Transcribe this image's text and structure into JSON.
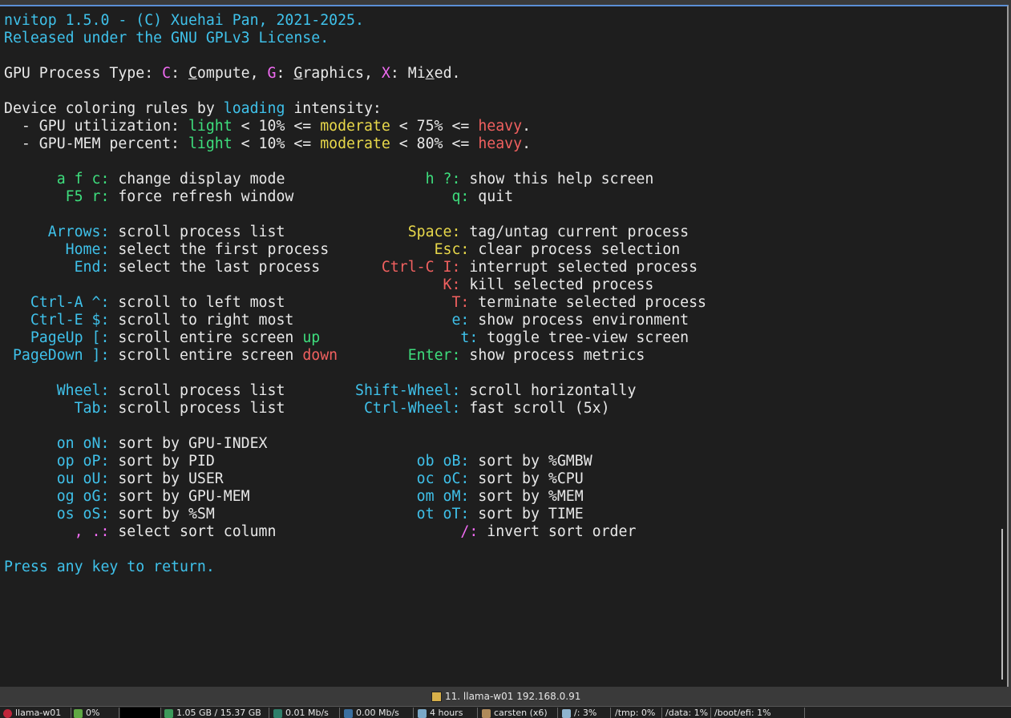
{
  "terminal": {
    "colors": {
      "background": "#1e1e1e",
      "cyan": "#3fc1ea",
      "green": "#3ede7d",
      "yellow": "#e8d84a",
      "red": "#f0605f",
      "magenta": "#f06bf2",
      "white": "#e8e8e8"
    },
    "lines": [
      {
        "row": 0,
        "segments": [
          {
            "t": "nvitop 1.5.0 - (C) Xuehai Pan, 2021-2025.",
            "c": "cy"
          }
        ]
      },
      {
        "row": 1,
        "segments": [
          {
            "t": "Released under the GNU GPLv3 License.",
            "c": "cy"
          }
        ]
      },
      {
        "row": 3,
        "segments": [
          {
            "t": "GPU Process Type: ",
            "c": "wh"
          },
          {
            "t": "C",
            "c": "mg"
          },
          {
            "t": ": ",
            "c": "wh"
          },
          {
            "t": "C",
            "c": "wh",
            "u": true
          },
          {
            "t": "ompute, ",
            "c": "wh"
          },
          {
            "t": "G",
            "c": "mg"
          },
          {
            "t": ": ",
            "c": "wh"
          },
          {
            "t": "G",
            "c": "wh",
            "u": true
          },
          {
            "t": "raphics, ",
            "c": "wh"
          },
          {
            "t": "X",
            "c": "mg"
          },
          {
            "t": ": Mi",
            "c": "wh"
          },
          {
            "t": "x",
            "c": "wh",
            "u": true
          },
          {
            "t": "ed.",
            "c": "wh"
          }
        ]
      },
      {
        "row": 5,
        "segments": [
          {
            "t": "Device coloring rules by ",
            "c": "wh"
          },
          {
            "t": "loading",
            "c": "cy"
          },
          {
            "t": " intensity:",
            "c": "wh"
          }
        ]
      },
      {
        "row": 6,
        "segments": [
          {
            "t": "  - GPU utilization: ",
            "c": "wh"
          },
          {
            "t": "light",
            "c": "gr"
          },
          {
            "t": " < 10% <= ",
            "c": "wh"
          },
          {
            "t": "moderate",
            "c": "ye"
          },
          {
            "t": " < 75% <= ",
            "c": "wh"
          },
          {
            "t": "heavy",
            "c": "rd"
          },
          {
            "t": ".",
            "c": "wh"
          }
        ]
      },
      {
        "row": 7,
        "segments": [
          {
            "t": "  - GPU-MEM percent: ",
            "c": "wh"
          },
          {
            "t": "light",
            "c": "gr"
          },
          {
            "t": " < 10% <= ",
            "c": "wh"
          },
          {
            "t": "moderate",
            "c": "ye"
          },
          {
            "t": " < 80% <= ",
            "c": "wh"
          },
          {
            "t": "heavy",
            "c": "rd"
          },
          {
            "t": ".",
            "c": "wh"
          }
        ]
      },
      {
        "row": 9,
        "segments": [
          {
            "t": "      a f c:",
            "c": "gr"
          },
          {
            "t": " change display mode               ",
            "c": "wh"
          },
          {
            "t": " h ?:",
            "c": "gr"
          },
          {
            "t": " show this help screen",
            "c": "wh"
          }
        ]
      },
      {
        "row": 10,
        "segments": [
          {
            "t": "       F5 r:",
            "c": "gr"
          },
          {
            "t": " force refresh window                  ",
            "c": "wh"
          },
          {
            "t": "q:",
            "c": "gr"
          },
          {
            "t": " quit",
            "c": "wh"
          }
        ]
      },
      {
        "row": 12,
        "segments": [
          {
            "t": "     Arrows:",
            "c": "cy"
          },
          {
            "t": " scroll process list              ",
            "c": "wh"
          },
          {
            "t": "Space:",
            "c": "ye"
          },
          {
            "t": " tag/untag current process",
            "c": "wh"
          }
        ]
      },
      {
        "row": 13,
        "segments": [
          {
            "t": "       Home:",
            "c": "cy"
          },
          {
            "t": " select the first process            ",
            "c": "wh"
          },
          {
            "t": "Esc:",
            "c": "ye"
          },
          {
            "t": " clear process selection",
            "c": "wh"
          }
        ]
      },
      {
        "row": 14,
        "segments": [
          {
            "t": "        End:",
            "c": "cy"
          },
          {
            "t": " select the last process       ",
            "c": "wh"
          },
          {
            "t": "Ctrl-C I:",
            "c": "rd"
          },
          {
            "t": " interrupt selected process",
            "c": "wh"
          }
        ]
      },
      {
        "row": 15,
        "segments": [
          {
            "t": "                                                  ",
            "c": "wh"
          },
          {
            "t": "K:",
            "c": "rd"
          },
          {
            "t": " kill selected process",
            "c": "wh"
          }
        ]
      },
      {
        "row": 16,
        "segments": [
          {
            "t": "   Ctrl-A ^:",
            "c": "cy"
          },
          {
            "t": " scroll to left most                   ",
            "c": "wh"
          },
          {
            "t": "T:",
            "c": "rd"
          },
          {
            "t": " terminate selected process",
            "c": "wh"
          }
        ]
      },
      {
        "row": 17,
        "segments": [
          {
            "t": "   Ctrl-E $:",
            "c": "cy"
          },
          {
            "t": " scroll to right most                  ",
            "c": "wh"
          },
          {
            "t": "e:",
            "c": "cy"
          },
          {
            "t": " show process environment",
            "c": "wh"
          }
        ]
      },
      {
        "row": 18,
        "segments": [
          {
            "t": "   PageUp [:",
            "c": "cy"
          },
          {
            "t": " scroll entire screen ",
            "c": "wh"
          },
          {
            "t": "up",
            "c": "gr"
          },
          {
            "t": "                ",
            "c": "wh"
          },
          {
            "t": "t:",
            "c": "cy"
          },
          {
            "t": " toggle tree-view screen",
            "c": "wh"
          }
        ]
      },
      {
        "row": 19,
        "segments": [
          {
            "t": " PageDown ]:",
            "c": "cy"
          },
          {
            "t": " scroll entire screen ",
            "c": "wh"
          },
          {
            "t": "down",
            "c": "rd"
          },
          {
            "t": "        ",
            "c": "wh"
          },
          {
            "t": "Enter:",
            "c": "gr"
          },
          {
            "t": " show process metrics",
            "c": "wh"
          }
        ]
      },
      {
        "row": 21,
        "segments": [
          {
            "t": "      Wheel:",
            "c": "cy"
          },
          {
            "t": " scroll process list        ",
            "c": "wh"
          },
          {
            "t": "Shift-Wheel:",
            "c": "cy"
          },
          {
            "t": " scroll horizontally",
            "c": "wh"
          }
        ]
      },
      {
        "row": 22,
        "segments": [
          {
            "t": "        Tab:",
            "c": "cy"
          },
          {
            "t": " scroll process list         ",
            "c": "wh"
          },
          {
            "t": "Ctrl-Wheel:",
            "c": "cy"
          },
          {
            "t": " fast scroll (5x)",
            "c": "wh"
          }
        ]
      },
      {
        "row": 24,
        "segments": [
          {
            "t": "      on oN:",
            "c": "cy"
          },
          {
            "t": " sort by GPU-INDEX",
            "c": "wh"
          }
        ]
      },
      {
        "row": 25,
        "segments": [
          {
            "t": "      op oP:",
            "c": "cy"
          },
          {
            "t": " sort by PID                       ",
            "c": "wh"
          },
          {
            "t": "ob oB:",
            "c": "cy"
          },
          {
            "t": " sort by %GMBW",
            "c": "wh"
          }
        ]
      },
      {
        "row": 26,
        "segments": [
          {
            "t": "      ou oU:",
            "c": "cy"
          },
          {
            "t": " sort by USER                      ",
            "c": "wh"
          },
          {
            "t": "oc oC:",
            "c": "cy"
          },
          {
            "t": " sort by %CPU",
            "c": "wh"
          }
        ]
      },
      {
        "row": 27,
        "segments": [
          {
            "t": "      og oG:",
            "c": "cy"
          },
          {
            "t": " sort by GPU-MEM                   ",
            "c": "wh"
          },
          {
            "t": "om oM:",
            "c": "cy"
          },
          {
            "t": " sort by %MEM",
            "c": "wh"
          }
        ]
      },
      {
        "row": 28,
        "segments": [
          {
            "t": "      os oS:",
            "c": "cy"
          },
          {
            "t": " sort by %SM                       ",
            "c": "wh"
          },
          {
            "t": "ot oT:",
            "c": "cy"
          },
          {
            "t": " sort by TIME",
            "c": "wh"
          }
        ]
      },
      {
        "row": 29,
        "segments": [
          {
            "t": "        , .:",
            "c": "mg"
          },
          {
            "t": " select sort column                     ",
            "c": "wh"
          },
          {
            "t": "/:",
            "c": "mg"
          },
          {
            "t": " invert sort order",
            "c": "wh"
          }
        ]
      },
      {
        "row": 31,
        "segments": [
          {
            "t": "Press any key to return.",
            "c": "cy"
          }
        ]
      }
    ]
  },
  "window": {
    "title": "11. llama-w01 192.168.0.91"
  },
  "taskbar": {
    "items": [
      {
        "icon": "debian-icon",
        "text": "llama-w01"
      },
      {
        "icon": "cpu-gear-icon",
        "text": "0%"
      },
      {
        "icon": "cpu-graph-icon",
        "text": ""
      },
      {
        "icon": "memory-icon",
        "text": "1.05 GB / 15.37 GB"
      },
      {
        "icon": "network-up-icon",
        "text": "0.01 Mb/s"
      },
      {
        "icon": "network-down-icon",
        "text": "0.00 Mb/s"
      },
      {
        "icon": "uptime-icon",
        "text": "4 hours"
      },
      {
        "icon": "user-icon",
        "text": "carsten (x6)"
      },
      {
        "icon": "disk-root-icon",
        "text": "/: 3%"
      },
      {
        "icon": "",
        "text": "/tmp: 0%"
      },
      {
        "icon": "",
        "text": "/data: 1%"
      },
      {
        "icon": "",
        "text": "/boot/efi: 1%"
      }
    ]
  }
}
